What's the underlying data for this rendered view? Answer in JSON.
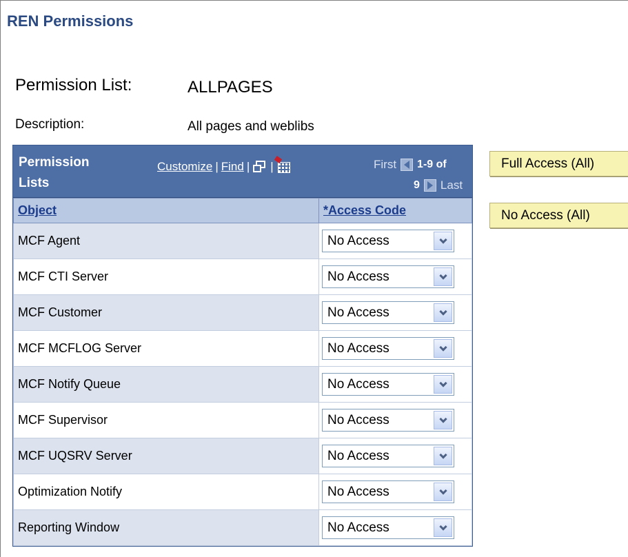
{
  "page": {
    "title": "REN Permissions"
  },
  "permission_list": {
    "label": "Permission List:",
    "value": "ALLPAGES"
  },
  "description": {
    "label": "Description:",
    "value": "All pages and weblibs"
  },
  "grid": {
    "title": "Permission Lists",
    "customize_label": "Customize",
    "find_label": "Find",
    "separator": "|",
    "new_window_icon": "new-window-icon",
    "download_icon": "grid-download-icon",
    "first_label": "First",
    "range_label": "1-9 of",
    "count_label": "9",
    "last_label": "Last",
    "columns": {
      "object": "Object",
      "access_code": "*Access Code"
    },
    "rows": [
      {
        "object": "MCF Agent",
        "access": "No Access"
      },
      {
        "object": "MCF CTI Server",
        "access": "No Access"
      },
      {
        "object": "MCF Customer",
        "access": "No Access"
      },
      {
        "object": "MCF MCFLOG Server",
        "access": "No Access"
      },
      {
        "object": "MCF Notify Queue",
        "access": "No Access"
      },
      {
        "object": "MCF Supervisor",
        "access": "No Access"
      },
      {
        "object": "MCF UQSRV Server",
        "access": "No Access"
      },
      {
        "object": "Optimization Notify",
        "access": "No Access"
      },
      {
        "object": "Reporting Window",
        "access": "No Access"
      }
    ]
  },
  "buttons": {
    "full_access": "Full Access (All)",
    "no_access": "No Access (All)"
  },
  "colors": {
    "title_blue": "#2b4a82",
    "grid_header_bg": "#4e6ea6",
    "column_header_bg": "#b9c9e3",
    "odd_row_bg": "#dce3ef",
    "button_bg": "#f7f3b3"
  }
}
